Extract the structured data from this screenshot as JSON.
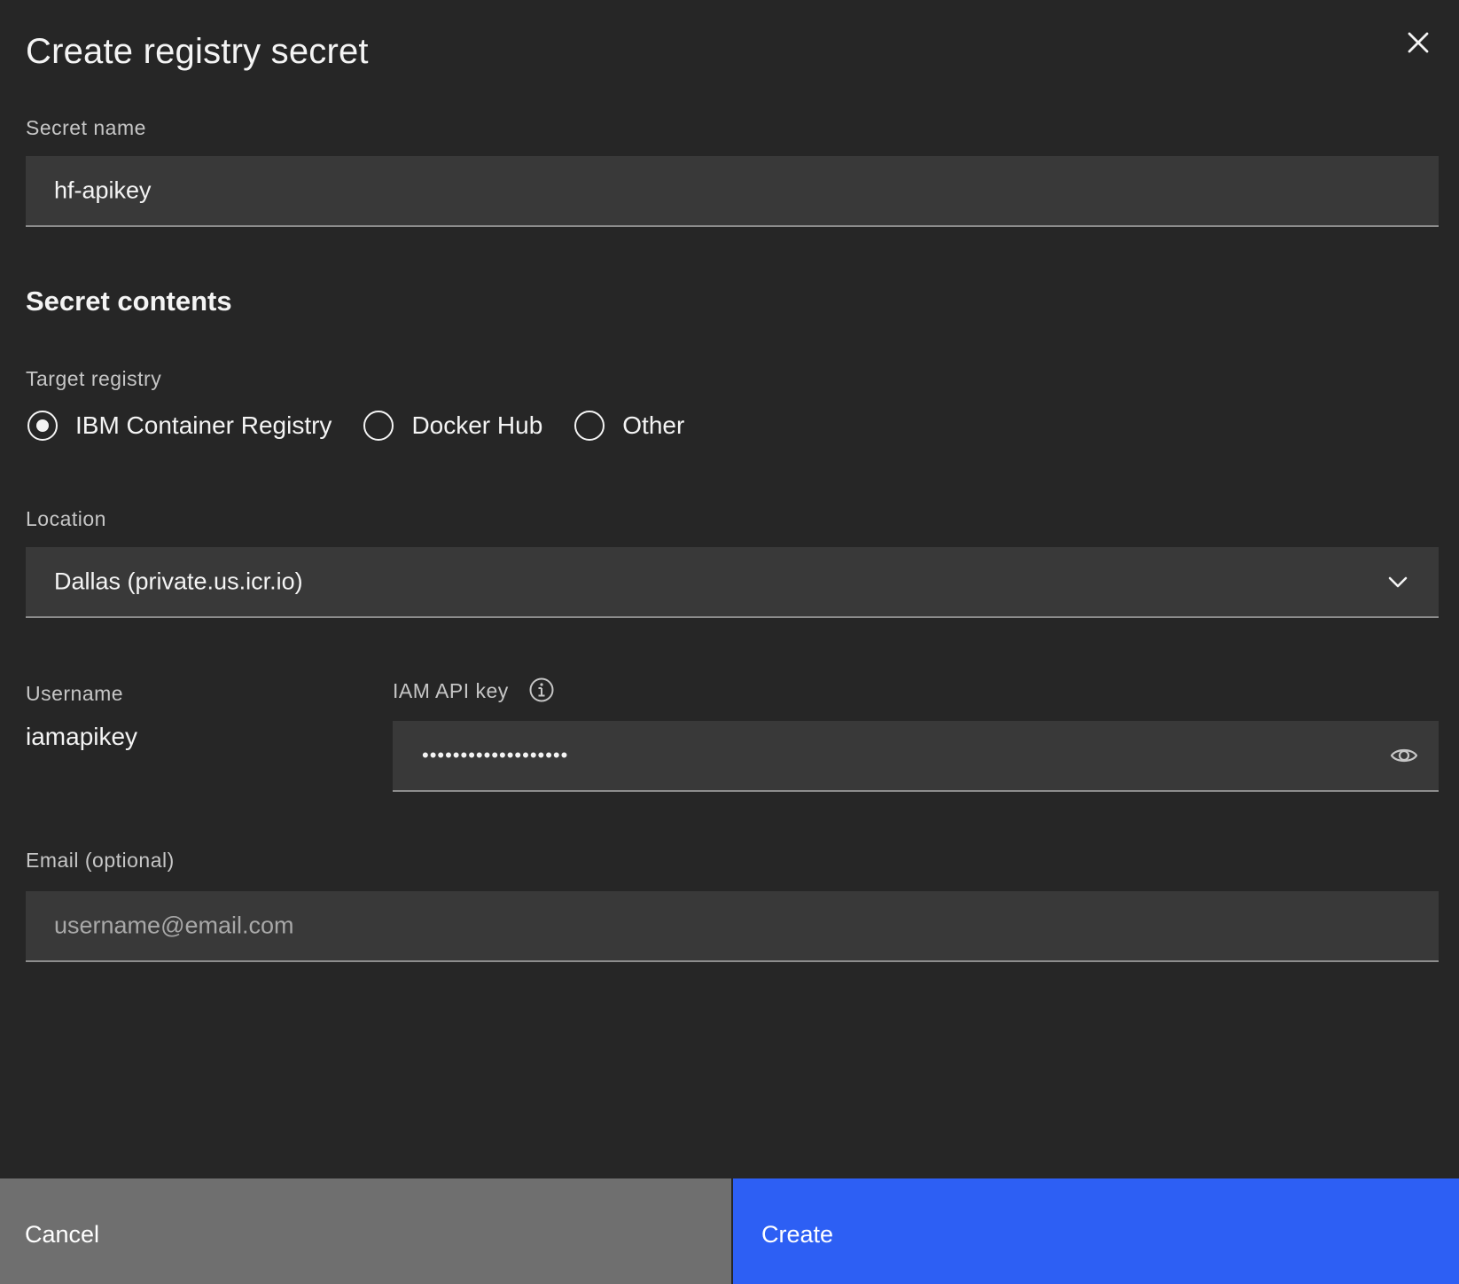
{
  "dialog": {
    "title": "Create registry secret",
    "close_icon": "close-icon"
  },
  "secret_name": {
    "label": "Secret name",
    "value": "hf-apikey"
  },
  "secret_contents": {
    "heading": "Secret contents"
  },
  "target_registry": {
    "label": "Target registry",
    "options": [
      {
        "label": "IBM Container Registry",
        "selected": true
      },
      {
        "label": "Docker Hub",
        "selected": false
      },
      {
        "label": "Other",
        "selected": false
      }
    ]
  },
  "location": {
    "label": "Location",
    "value": "Dallas (private.us.icr.io)",
    "icon": "chevron-down-icon"
  },
  "username": {
    "label": "Username",
    "value": "iamapikey"
  },
  "api_key": {
    "label": "IAM API key",
    "masked_value": "•••••••••••••••••••",
    "info_icon": "info-icon",
    "toggle_icon": "eye-icon"
  },
  "email": {
    "label": "Email (optional)",
    "placeholder": "username@email.com",
    "value": ""
  },
  "footer": {
    "cancel_label": "Cancel",
    "create_label": "Create"
  },
  "colors": {
    "background": "#262626",
    "field": "#393939",
    "primary": "#2d5ff4",
    "secondary": "#6f6f6f"
  }
}
